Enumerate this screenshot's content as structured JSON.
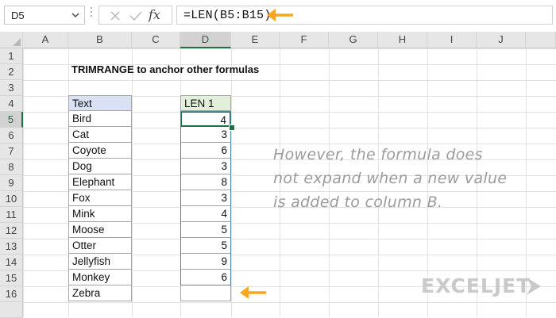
{
  "formula_bar": {
    "name_box": "D5",
    "fx_label": "fx",
    "formula": "=LEN(B5:B15)"
  },
  "columns": [
    "A",
    "B",
    "C",
    "D",
    "E",
    "F",
    "G",
    "H",
    "I",
    "J"
  ],
  "rows": [
    "1",
    "2",
    "3",
    "4",
    "5",
    "6",
    "7",
    "8",
    "9",
    "10",
    "11",
    "12",
    "13",
    "14",
    "15",
    "16"
  ],
  "sheet": {
    "title": "TRIMRANGE to anchor other formulas",
    "text_header": "Text",
    "len_header": "LEN 1",
    "text_values": [
      "Bird",
      "Cat",
      "Coyote",
      "Dog",
      "Elephant",
      "Fox",
      "Mink",
      "Moose",
      "Otter",
      "Jellyfish",
      "Monkey",
      "Zebra"
    ],
    "len_values": [
      "4",
      "3",
      "6",
      "3",
      "8",
      "3",
      "4",
      "5",
      "5",
      "9",
      "6"
    ]
  },
  "note": "However, the formula does not expand when a new value is added to column B.",
  "logo": "EXCELJET",
  "colors": {
    "accent_green": "#1e7145",
    "arrow_orange": "#f5a623",
    "text_header_fill": "#d9e1f2",
    "len_header_fill": "#e2efda"
  }
}
